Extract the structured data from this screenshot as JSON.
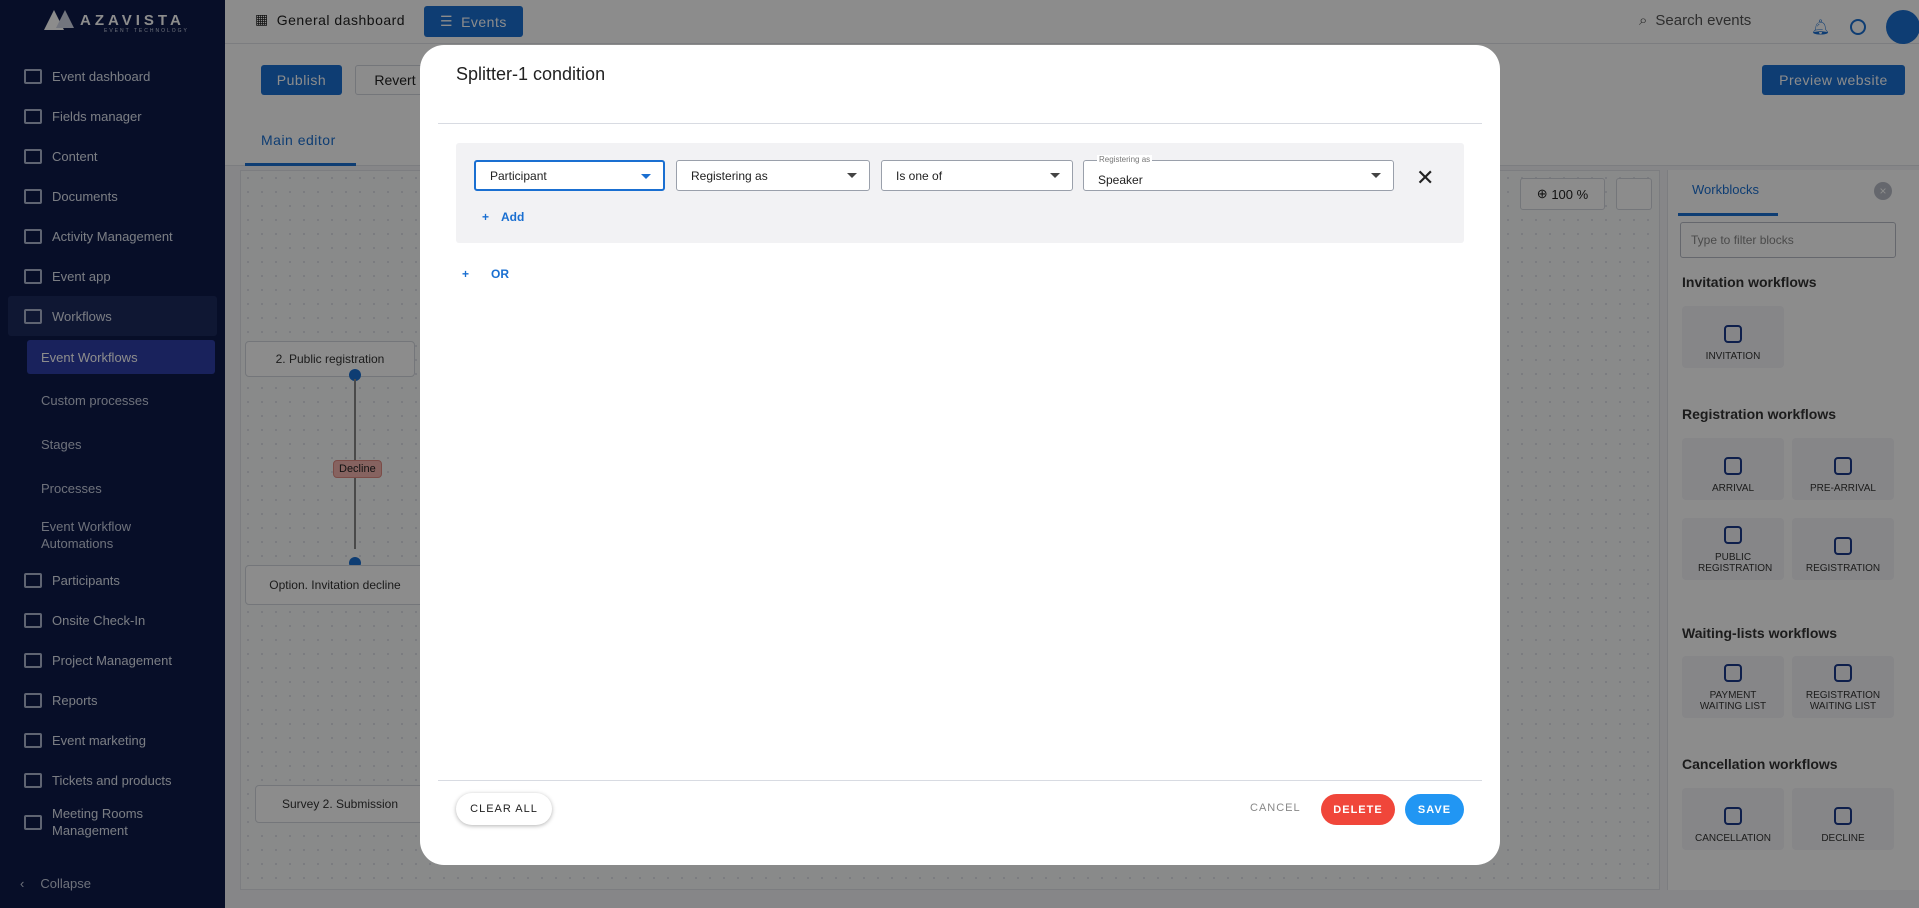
{
  "brand": {
    "name": "AZAVISTA",
    "tagline": "EVENT TECHNOLOGY"
  },
  "sidebar": {
    "items": [
      {
        "label": "Event dashboard",
        "icon": "dashboard-icon"
      },
      {
        "label": "Fields manager",
        "icon": "fields-icon"
      },
      {
        "label": "Content",
        "icon": "content-icon"
      },
      {
        "label": "Documents",
        "icon": "document-icon"
      },
      {
        "label": "Activity Management",
        "icon": "calendar-icon"
      },
      {
        "label": "Event app",
        "icon": "phone-icon"
      },
      {
        "label": "Workflows",
        "icon": "workflow-icon"
      }
    ],
    "sub_items": [
      "Event Workflows",
      "Custom processes",
      "Stages",
      "Processes",
      "Event Workflow Automations"
    ],
    "items2": [
      {
        "label": "Participants",
        "icon": "person-icon"
      },
      {
        "label": "Onsite Check-In",
        "icon": "mail-icon"
      },
      {
        "label": "Project Management",
        "icon": "calendar-icon"
      },
      {
        "label": "Reports",
        "icon": "chart-icon"
      },
      {
        "label": "Event marketing",
        "icon": "calendar-icon"
      },
      {
        "label": "Tickets and products",
        "icon": "card-icon"
      },
      {
        "label": "Meeting Rooms Management",
        "icon": "door-icon"
      }
    ],
    "collapse_label": "Collapse"
  },
  "topbar": {
    "general_label": "General dashboard",
    "events_label": "Events",
    "search_placeholder": "Search events"
  },
  "toolbar": {
    "publish_label": "Publish",
    "revert_label": "Revert",
    "preview_label": "Preview website",
    "main_tab_label": "Main editor",
    "zoom_label": "100 %"
  },
  "canvas": {
    "node_public_reg": "2. Public registration",
    "node_invitation_decline": "Option. Invitation decline",
    "node_survey": "Survey 2. Submission",
    "decline_tag": "Decline"
  },
  "panel": {
    "tab_label": "Workblocks",
    "filter_placeholder": "Type to filter blocks",
    "groups": {
      "invitation": "Invitation workflows",
      "registration": "Registration workflows",
      "waiting": "Waiting-lists workflows",
      "cancellation": "Cancellation workflows"
    },
    "blocks": {
      "invitation": "INVITATION",
      "arrival": "ARRIVAL",
      "pre_arrival": "PRE-ARRIVAL",
      "public_registration": "PUBLIC REGISTRATION",
      "registration": "REGISTRATION",
      "payment_waiting": "PAYMENT WAITING LIST",
      "registration_waiting": "REGISTRATION WAITING LIST",
      "cancellation": "CANCELLATION",
      "decline": "DECLINE"
    }
  },
  "modal": {
    "title": "Splitter-1 condition",
    "condition": {
      "subject": "Participant",
      "field": "Registering as",
      "operator": "Is one of",
      "value_legend": "Registering as",
      "value": "Speaker"
    },
    "add_label": "Add",
    "or_label": "OR",
    "clear_all_label": "CLEAR ALL",
    "cancel_label": "CANCEL",
    "delete_label": "DELETE",
    "save_label": "SAVE",
    "colors": {
      "primary": "#1a6fd1",
      "delete": "#f0463a",
      "save": "#2196f3"
    }
  }
}
